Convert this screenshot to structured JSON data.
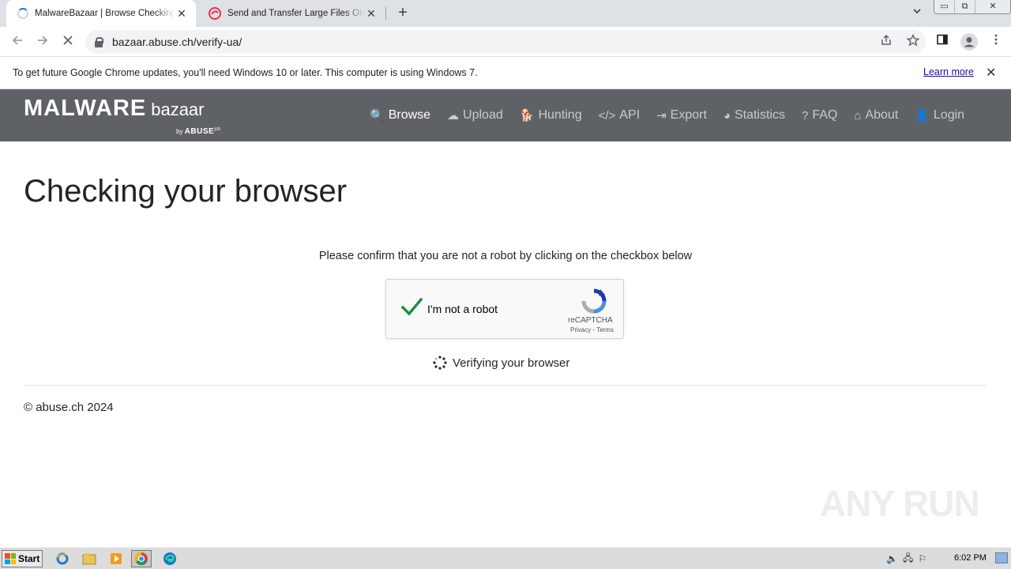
{
  "tabs": [
    {
      "title": "MalwareBazaar | Browse Checking your browser",
      "close": "✕"
    },
    {
      "title": "Send and Transfer Large Files Online",
      "close": "✕"
    }
  ],
  "newtab": "+",
  "window_buttons": {
    "minimize": "▭",
    "restore": "⧉",
    "close": "✕"
  },
  "url": "bazaar.abuse.ch/verify-ua/",
  "infobar": {
    "message": "To get future Google Chrome updates, you'll need Windows 10 or later. This computer is using Windows 7.",
    "link": "Learn more",
    "close": "✕"
  },
  "site": {
    "logo_big": "MALWARE",
    "logo_small": "bazaar",
    "logo_by": "by",
    "logo_abuse": "ABUSE",
    "logo_ch": "|ch",
    "menu": [
      {
        "label": "Browse",
        "icon": "search-icon",
        "glyph": "🔍"
      },
      {
        "label": "Upload",
        "icon": "cloud-upload-icon",
        "glyph": "☁"
      },
      {
        "label": "Hunting",
        "icon": "dog-icon",
        "glyph": "🐕"
      },
      {
        "label": "API",
        "icon": "code-icon",
        "glyph": "</>"
      },
      {
        "label": "Export",
        "icon": "file-export-icon",
        "glyph": "⇥"
      },
      {
        "label": "Statistics",
        "icon": "pie-chart-icon",
        "glyph": "◕"
      },
      {
        "label": "FAQ",
        "icon": "question-icon",
        "glyph": "?"
      },
      {
        "label": "About",
        "icon": "building-icon",
        "glyph": "⌂"
      },
      {
        "label": "Login",
        "icon": "user-icon",
        "glyph": "👤"
      }
    ]
  },
  "page": {
    "title": "Checking your browser",
    "confirm": "Please confirm that you are not a robot by clicking on the checkbox below",
    "captcha_label": "I'm not a robot",
    "captcha_brand": "reCAPTCHA",
    "captcha_links": "Privacy - Terms",
    "verifying": "Verifying your browser",
    "copyright": "© abuse.ch 2024"
  },
  "watermark": "ANY RUN",
  "taskbar": {
    "start": "Start",
    "clock": "6:02 PM"
  },
  "colors": {
    "nav_bg": "#5e6266",
    "check_green": "#1e8e3e",
    "link": "#1a0dab"
  }
}
